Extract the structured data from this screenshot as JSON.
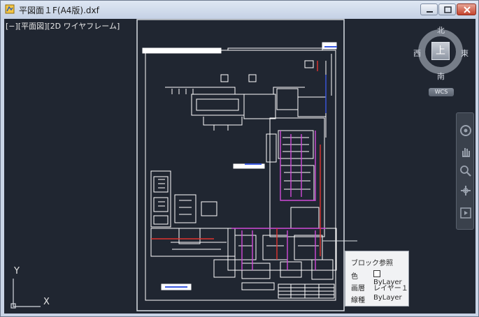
{
  "window": {
    "title": "平図面１F(A4版).dxf",
    "buttons": {
      "minimize": "minimize",
      "maximize": "maximize",
      "close": "close"
    }
  },
  "viewport": {
    "label": "[−][平面図][2D ワイヤフレーム]",
    "background": "#202631"
  },
  "viewcube": {
    "north": "北",
    "south": "南",
    "east": "東",
    "west": "西",
    "face": "上",
    "wcs_label": "WCS"
  },
  "navbar": {
    "items": [
      "steering-wheel-icon",
      "pan-hand-icon",
      "zoom-icon",
      "orbit-icon",
      "showmotion-icon"
    ]
  },
  "tooltip": {
    "title": "ブロック参照",
    "rows": [
      {
        "key": "色",
        "value": "ByLayer"
      },
      {
        "key": "画層",
        "value": "レイヤー１"
      },
      {
        "key": "線種",
        "value": "ByLayer"
      }
    ]
  },
  "ucs": {
    "x_label": "X",
    "y_label": "Y"
  },
  "colors": {
    "accent_magenta": "#d04ad8",
    "accent_red": "#e0342f",
    "accent_blue": "#3a58e0",
    "linework": "#ffffff"
  }
}
